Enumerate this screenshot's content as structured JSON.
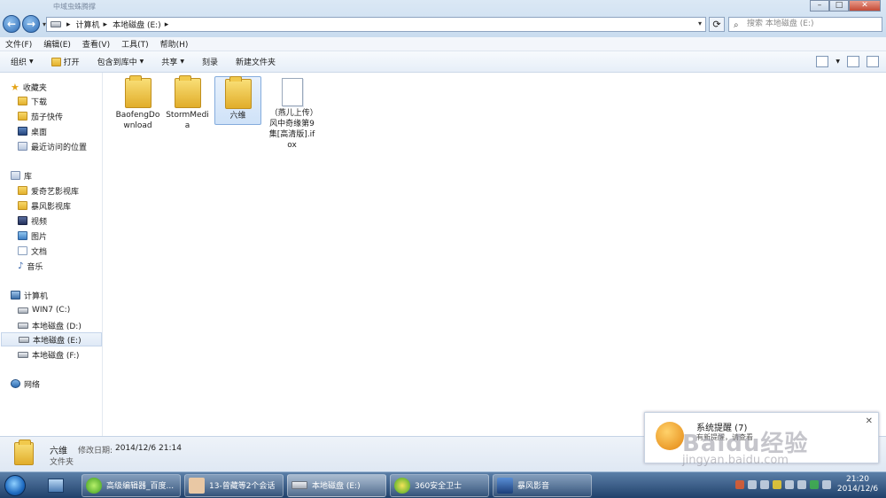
{
  "window": {
    "title": "中域虫蛛腾撑",
    "buttons": {
      "min": "–",
      "max": "□",
      "close": "✕"
    }
  },
  "address": {
    "crumbs": [
      "计算机",
      "本地磁盘 (E:)"
    ],
    "search_placeholder": "搜索 本地磁盘 (E:)"
  },
  "menu": [
    "文件(F)",
    "编辑(E)",
    "查看(V)",
    "工具(T)",
    "帮助(H)"
  ],
  "toolbar": {
    "organize": "组织",
    "open": "打开",
    "include": "包含到库中",
    "share": "共享",
    "burn": "刻录",
    "new_folder": "新建文件夹"
  },
  "sidebar": {
    "favorites": "收藏夹",
    "fav_items": [
      "下载",
      "茄子快传",
      "桌面",
      "最近访问的位置"
    ],
    "libraries": "库",
    "lib_items": [
      "爱奇艺影视库",
      "暴风影视库",
      "视频",
      "图片",
      "文档",
      "音乐"
    ],
    "computer": "计算机",
    "drives": [
      "WIN7 (C:)",
      "本地磁盘 (D:)",
      "本地磁盘 (E:)",
      "本地磁盘 (F:)"
    ],
    "network": "网络"
  },
  "files": [
    {
      "name": "BaofengDownload",
      "type": "folder"
    },
    {
      "name": "StormMedia",
      "type": "folder"
    },
    {
      "name": "六维",
      "type": "folder",
      "selected": true
    },
    {
      "name": "（燕儿上传）风中奇缘第9集[高清版].ifox",
      "type": "file"
    }
  ],
  "details": {
    "name": "六维",
    "modified_label": "修改日期:",
    "modified_value": "2014/12/6 21:14",
    "type": "文件夹"
  },
  "notification": {
    "title": "系统提醒 (7)",
    "message": "有新提醒，请查看",
    "close": "✕"
  },
  "watermark": {
    "line1": "Baidu经验",
    "line2": "jingyan.baidu.com"
  },
  "taskbar": {
    "tasks": [
      "高级编辑器_百度...",
      "13-曾藏等2个会话",
      "本地磁盘 (E:)",
      "360安全卫士",
      "暴风影音"
    ],
    "time": "21:20",
    "date": "2014/12/6"
  }
}
